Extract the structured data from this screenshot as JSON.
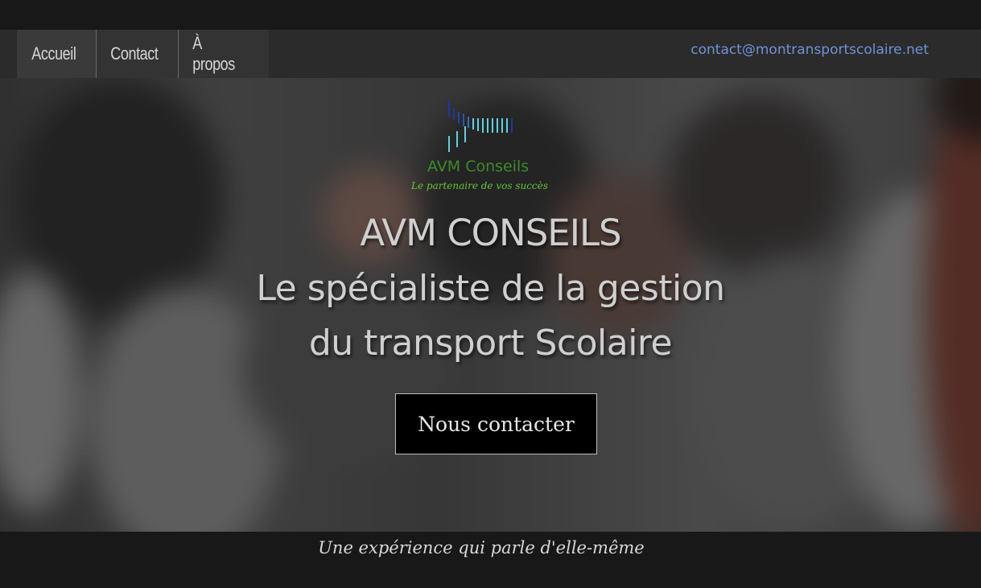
{
  "nav": {
    "items": [
      {
        "label": "Accueil"
      },
      {
        "label": "Contact"
      },
      {
        "label": "À propos"
      }
    ],
    "email": "contact@montransportscolaire.net"
  },
  "logo": {
    "name": "AVM Conseils",
    "tagline": "Le partenaire de vos succès"
  },
  "hero": {
    "title": "AVM CONSEILS",
    "subtitle_line1": "Le spécialiste de la gestion",
    "subtitle_line2": "du transport Scolaire",
    "cta_label": "Nous contacter"
  },
  "footer": {
    "tagline": "Une expérience qui parle d'elle-même"
  },
  "colors": {
    "nav_bg": "#2b2b2b",
    "email_link": "#6f93d8",
    "logo_green": "#3f8a2a",
    "logo_bars_dark": "#1c3a9a",
    "logo_bars_light": "#5fd0e0"
  }
}
